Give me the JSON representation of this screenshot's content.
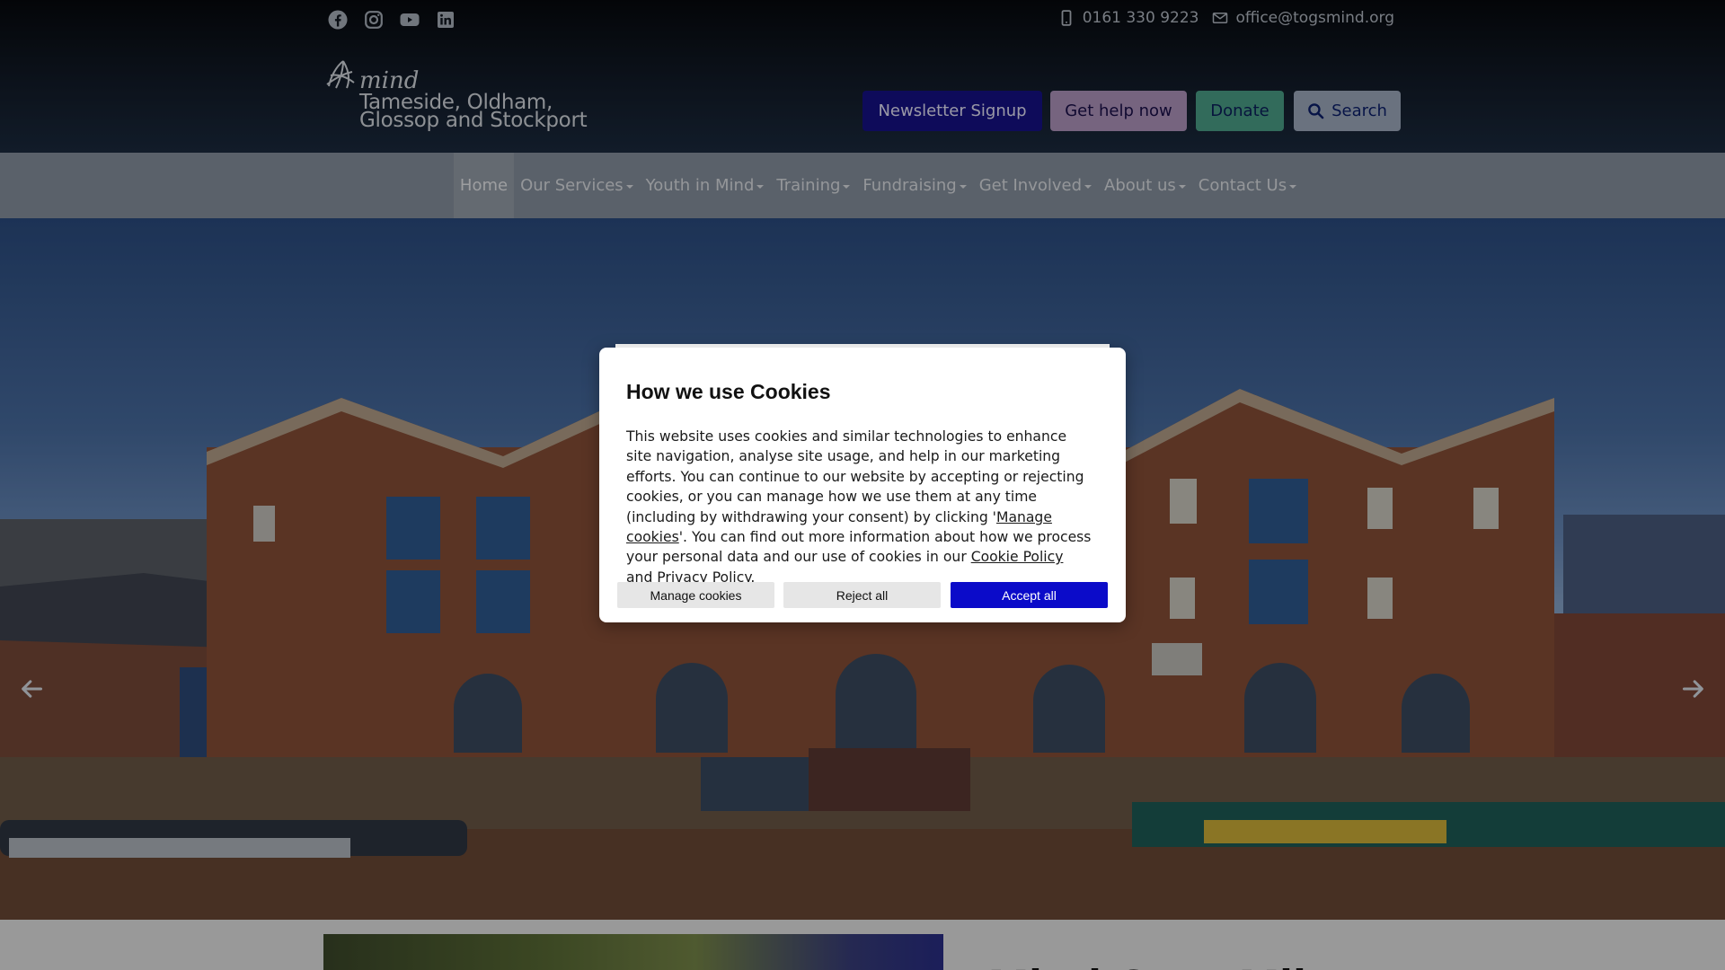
{
  "colors": {
    "header_bg": "#131d2b",
    "nav_bg": "#8b95a3",
    "newsletter_bg": "#16118a",
    "help_bg": "#b59ac4",
    "donate_bg": "#4da58c",
    "search_bg": "#a3b0c4",
    "accept_bg": "#0b0bc9"
  },
  "topbar": {
    "social": [
      "facebook-icon",
      "instagram-icon",
      "youtube-icon",
      "linkedin-icon"
    ],
    "phone": "0161 330 9223",
    "email": "office@togsmind.org"
  },
  "logo": {
    "mark": "mind",
    "line1": "Tameside, Oldham,",
    "line2": "Glossop and Stockport"
  },
  "actions": {
    "newsletter": "Newsletter Signup",
    "help": "Get help now",
    "donate": "Donate",
    "search": "Search"
  },
  "nav": {
    "items": [
      {
        "label": "Home",
        "active": true,
        "dropdown": false
      },
      {
        "label": "Our Services",
        "dropdown": true
      },
      {
        "label": "Youth in Mind",
        "dropdown": true
      },
      {
        "label": "Training",
        "dropdown": true
      },
      {
        "label": "Fundraising",
        "dropdown": true
      },
      {
        "label": "Get Involved",
        "dropdown": true
      },
      {
        "label": "About us",
        "dropdown": true
      },
      {
        "label": "Contact Us",
        "dropdown": true
      }
    ]
  },
  "hero": {
    "prev_icon": "arrow-left-icon",
    "next_icon": "arrow-right-icon"
  },
  "below": {
    "headline": "Mind Over Mil"
  },
  "cookie": {
    "title": "How we use Cookies",
    "body_part1": "This website uses cookies and similar technologies to enhance site navigation, analyse site usage, and help in our marketing efforts. You can continue to our website by accepting or rejecting cookies, or you can manage how we use them at any time (including by withdrawing your consent) by clicking '",
    "manage_link": "Manage cookies",
    "body_part2": "'. You can find out more information about how we process your personal data and our use of cookies in our ",
    "cookie_policy_link": "Cookie Policy",
    "body_and": " and ",
    "privacy_policy_link": "Privacy Policy",
    "body_end": ".",
    "btn_manage": "Manage cookies",
    "btn_reject": "Reject all",
    "btn_accept": "Accept all"
  }
}
